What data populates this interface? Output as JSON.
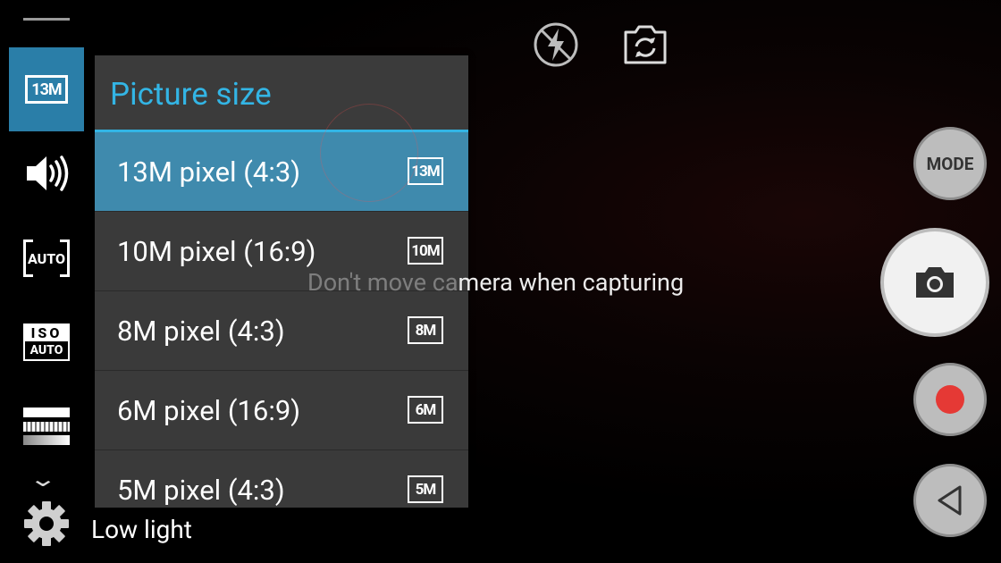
{
  "left_settings": [
    {
      "name": "picture-size",
      "label": "13M",
      "selected": true
    },
    {
      "name": "volume",
      "icon": "volume-icon"
    },
    {
      "name": "focus",
      "label": "AUTO"
    },
    {
      "name": "iso",
      "top": "ISO",
      "bottom": "AUTO"
    },
    {
      "name": "hdr",
      "icon": "hdr-icon"
    }
  ],
  "bottom_left": {
    "chevron": "⌄",
    "low_light_label": "Low light"
  },
  "top_icons": [
    "flash-off-icon",
    "switch-camera-icon"
  ],
  "dialog": {
    "title": "Picture size",
    "options": [
      {
        "label": "13M pixel (4:3)",
        "badge": "13M",
        "selected": true
      },
      {
        "label": "10M pixel (16:9)",
        "badge": "10M",
        "selected": false
      },
      {
        "label": "8M pixel (4:3)",
        "badge": "8M",
        "selected": false
      },
      {
        "label": "6M pixel (16:9)",
        "badge": "6M",
        "selected": false
      },
      {
        "label": "5M pixel (4:3)",
        "badge": "5M",
        "selected": false
      }
    ]
  },
  "hint": {
    "part_hidden": "Don't move ca",
    "part_visible": "mera when capturing"
  },
  "controls": {
    "mode_label": "MODE"
  },
  "colors": {
    "accent": "#33b5e5",
    "selected_bg": "#3f8aad",
    "record": "#e53935"
  }
}
